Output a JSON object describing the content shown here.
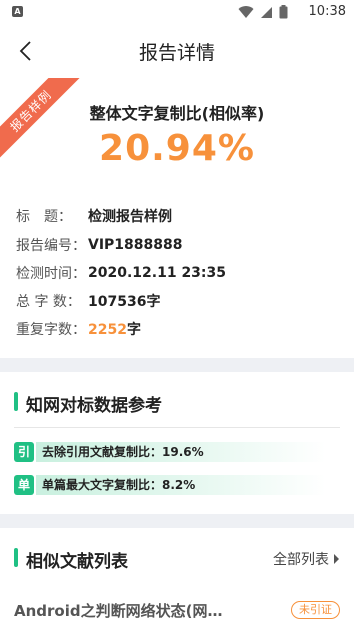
{
  "status_bar": {
    "app_icon_letter": "A",
    "time": "10:38"
  },
  "nav": {
    "title": "报告详情"
  },
  "summary": {
    "ribbon": "报告样例",
    "label": "整体文字复制比(相似率)",
    "rate": "20.94%"
  },
  "info": [
    {
      "key": "标　题：",
      "value": "检测报告样例"
    },
    {
      "key": "报告编号：",
      "value": "VIP1888888"
    },
    {
      "key": "检测时间：",
      "value": "2020.12.11 23:35"
    },
    {
      "key": "总 字 数：",
      "value": "107536字"
    },
    {
      "key": "重复字数：",
      "value_highlight": "2252",
      "value_suffix": "字"
    }
  ],
  "benchmark": {
    "title": "知网对标数据参考",
    "metrics": [
      {
        "badge": "引",
        "text": "去除引用文献复制比：19.6%"
      },
      {
        "badge": "单",
        "text": "单篇最大文字复制比：8.2%"
      }
    ]
  },
  "similar": {
    "title": "相似文献列表",
    "more_label": "全部列表",
    "items": [
      {
        "title": "Android之判断网络状态(网…",
        "tag": "未引证"
      }
    ]
  },
  "colors": {
    "accent_orange": "#f7913b",
    "accent_green": "#20c084",
    "ribbon_red": "#f06b4d"
  }
}
